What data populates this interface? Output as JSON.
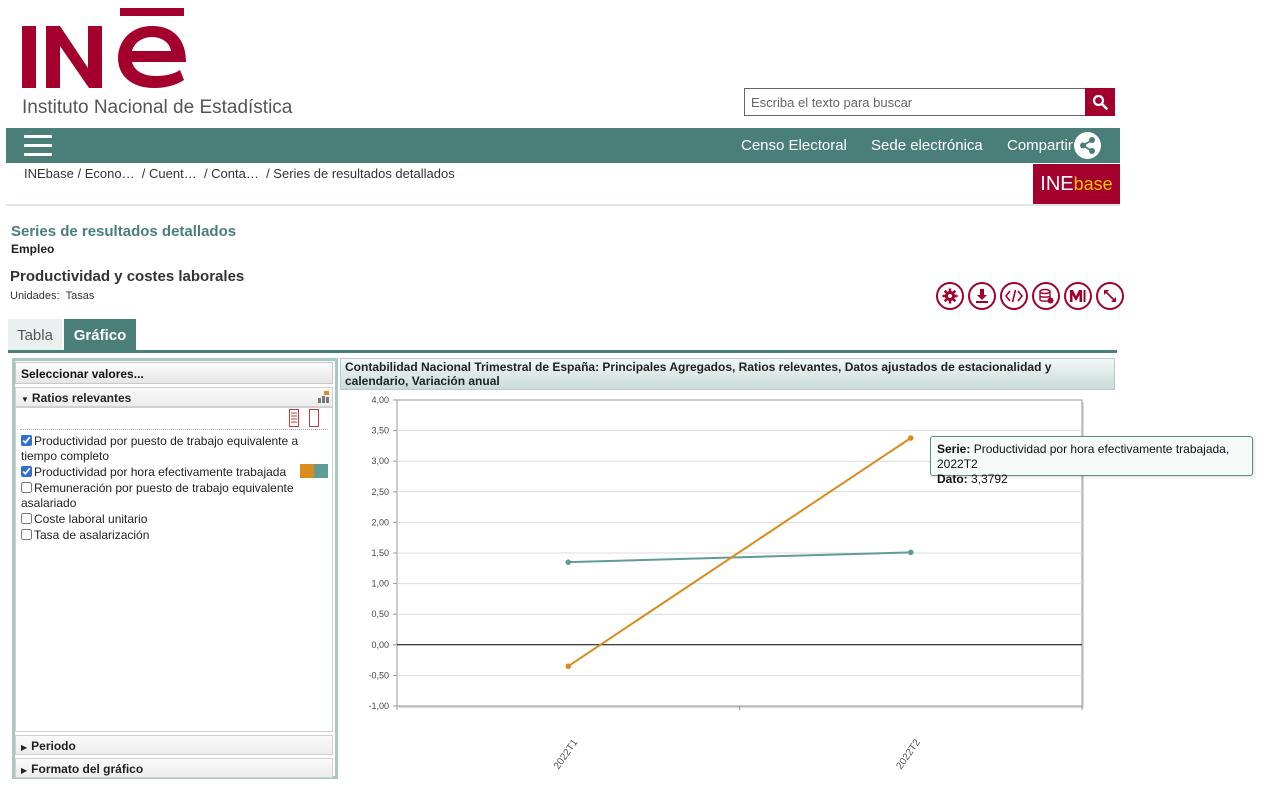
{
  "header": {
    "logo_text": "INE",
    "logo_subtitle": "Instituto Nacional de Estadística",
    "search_placeholder": "Escriba el texto para buscar",
    "brand_color": "#a3002e",
    "nav_color": "#4a7f79"
  },
  "nav": {
    "links": [
      "Censo Electoral",
      "Sede electrónica",
      "Compartir"
    ]
  },
  "breadcrumb": [
    "INEbase",
    " / Econo…",
    "  / Cuent…",
    "  / Conta…",
    "  / Series de resultados detallados"
  ],
  "inebase_logo": {
    "ine": "INE",
    "base": "base"
  },
  "page": {
    "title": "Series de resultados detallados",
    "subtitle": "Empleo",
    "section_title": "Productividad y costes laborales",
    "units_label": "Unidades:",
    "units_value": "Tasas"
  },
  "tools": [
    "settings-icon",
    "download-icon",
    "embed-icon",
    "database-icon",
    "metadata-icon",
    "expand-icon"
  ],
  "tabs": {
    "tabla": "Tabla",
    "grafico": "Gráfico"
  },
  "left_panel": {
    "header": "Seleccionar valores...",
    "ratios_title": "Ratios relevantes",
    "items": [
      {
        "label": "Productividad por puesto de trabajo equivalente a tiempo completo",
        "checked": true
      },
      {
        "label": "Productividad por hora efectivamente trabajada",
        "checked": true
      },
      {
        "label": "Remuneración por puesto de trabajo equivalente asalariado",
        "checked": false
      },
      {
        "label": "Coste laboral unitario",
        "checked": false
      },
      {
        "label": "Tasa de asalarización",
        "checked": false
      }
    ],
    "periodo": "Periodo",
    "formato": "Formato del gráfico"
  },
  "chart_data": {
    "type": "line",
    "title": "Contabilidad Nacional Trimestral de España: Principales Agregados, Ratios relevantes, Datos ajustados de estacionalidad y calendario, Variación anual",
    "categories": [
      "2022T1",
      "2022T2"
    ],
    "series": [
      {
        "name": "Productividad por puesto de trabajo equivalente a tiempo completo",
        "color": "#5f9c97",
        "values": [
          1.35,
          1.51
        ]
      },
      {
        "name": "Productividad por hora efectivamente trabajada",
        "color": "#d98c1a",
        "values": [
          -0.35,
          3.3792
        ]
      }
    ],
    "ylim": [
      -1.0,
      4.0
    ],
    "yticks": [
      "4,00",
      "3,50",
      "3,00",
      "2,50",
      "2,00",
      "1,50",
      "1,00",
      "0,50",
      "0,00",
      "-0,50",
      "-1,00"
    ],
    "grid": true
  },
  "tooltip": {
    "serie_label": "Serie:",
    "serie_value": "Productividad por hora efectivamente trabajada, 2022T2",
    "dato_label": "Dato:",
    "dato_value": "3,3792"
  }
}
